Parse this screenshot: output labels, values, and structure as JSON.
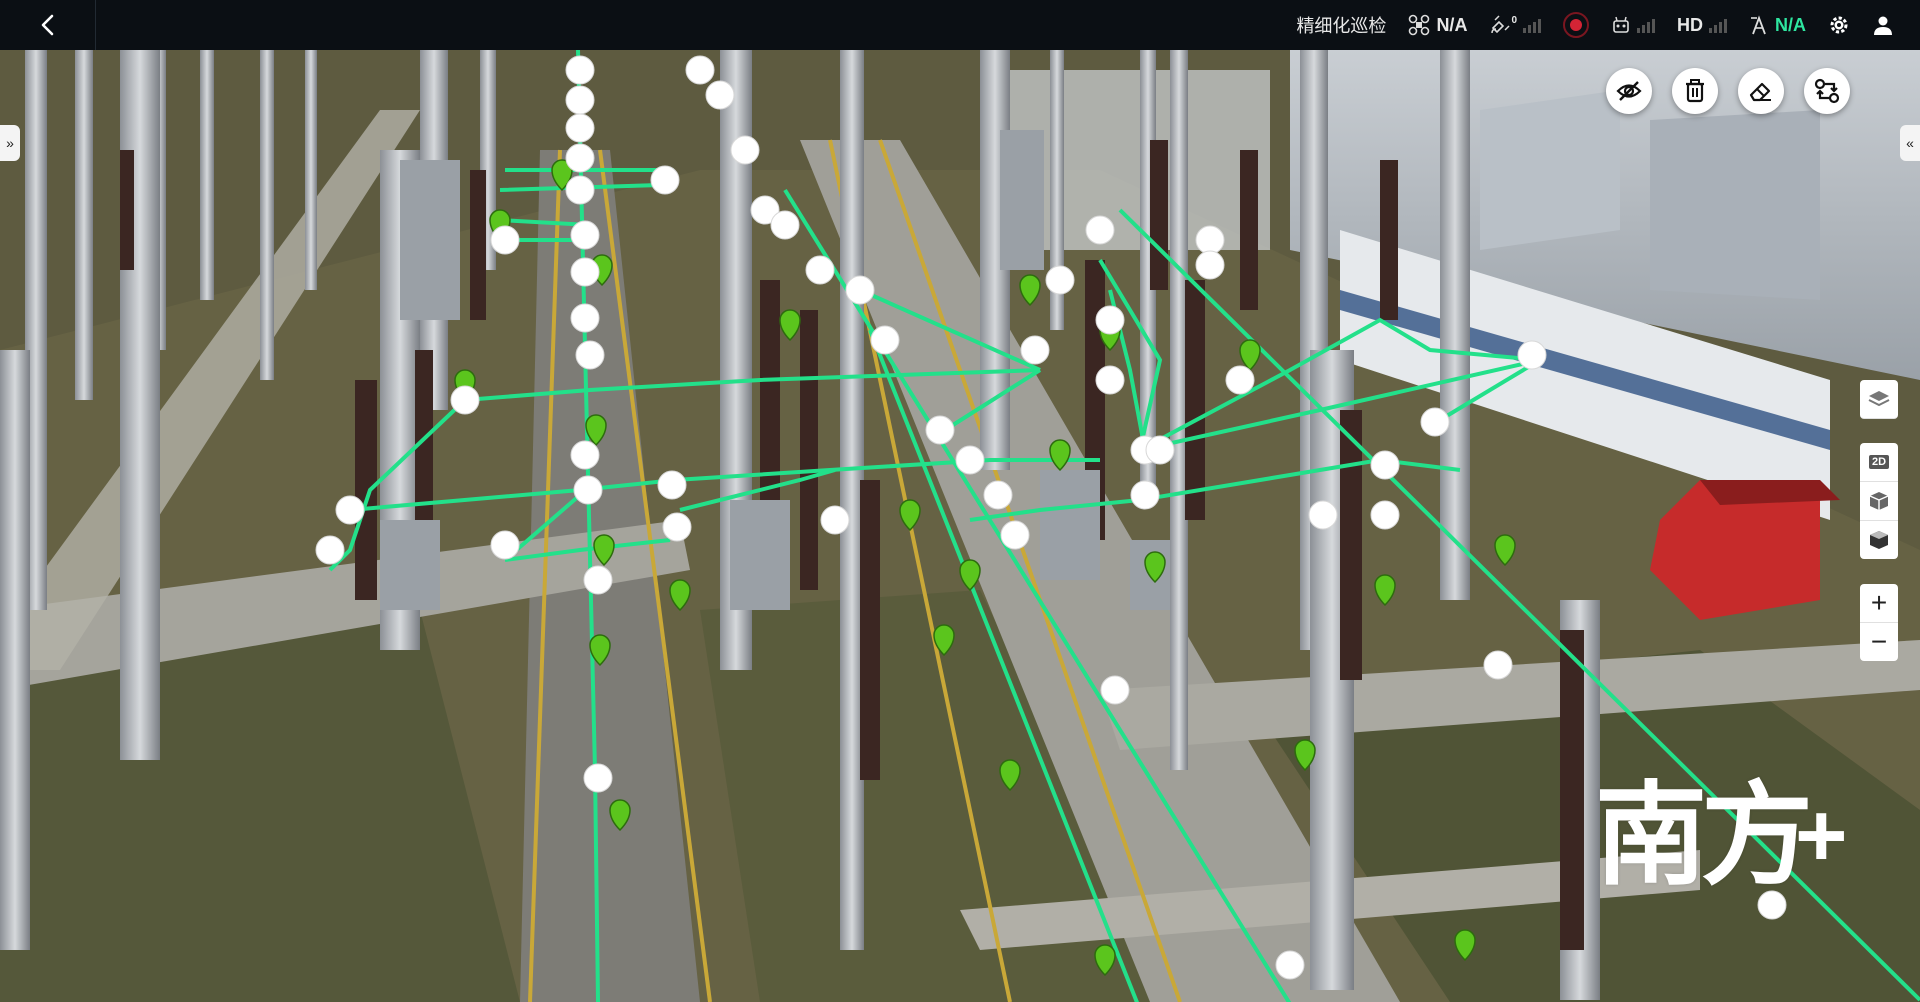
{
  "topbar": {
    "mode_label": "精细化巡检",
    "drone_status": "N/A",
    "gps_count": "0",
    "video_quality": "HD",
    "rtk_status": "N/A",
    "icons": [
      "back-arrow-icon",
      "drone-icon",
      "satellite-icon",
      "record-icon",
      "remote-controller-icon",
      "signal-icon",
      "rtk-icon",
      "gear-icon",
      "user-icon"
    ]
  },
  "toolbar": {
    "buttons": [
      {
        "name": "hide-visibility",
        "icon": "eye-off-icon"
      },
      {
        "name": "delete",
        "icon": "trash-icon"
      },
      {
        "name": "erase",
        "icon": "eraser-icon"
      },
      {
        "name": "swap-route",
        "icon": "route-swap-icon"
      }
    ]
  },
  "side_tools": {
    "view_2d": "2D",
    "zoom_in": "+",
    "zoom_out": "−",
    "icons": [
      "layers-icon",
      "view-2d-icon",
      "cube-solid-icon",
      "cube-wire-icon",
      "zoom-in-icon",
      "zoom-out-icon"
    ]
  },
  "edge_tabs": {
    "left": "»",
    "right": "«"
  },
  "watermark": {
    "text": "南方",
    "plus": "+"
  },
  "colors": {
    "route_line": "#23e08a",
    "waypoint": "#ffffff",
    "marker": "#5bc51d",
    "topbar_bg": "#0b0f14",
    "accent_green": "#2ee6a0"
  }
}
